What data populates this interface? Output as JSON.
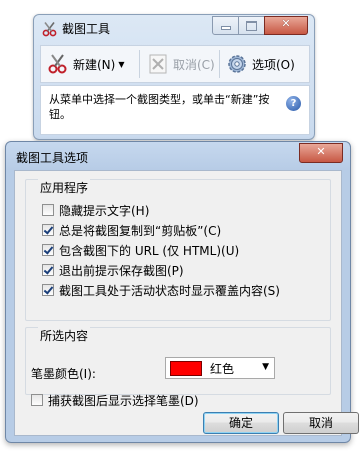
{
  "snipping_tool": {
    "title": "截图工具",
    "toolbar": {
      "new_label": "新建(N)",
      "cancel_label": "取消(C)",
      "options_label": "选项(O)"
    },
    "hint": "从菜单中选择一个截图类型，或单击“新建”按钮。"
  },
  "options_dialog": {
    "title": "截图工具选项",
    "app_group": {
      "title": "应用程序",
      "options": [
        {
          "label": "隐藏提示文字(H)",
          "checked": false
        },
        {
          "label": "总是将截图复制到“剪贴板”(C)",
          "checked": true
        },
        {
          "label": "包含截图下的 URL (仅 HTML)(U)",
          "checked": true
        },
        {
          "label": "退出前提示保存截图(P)",
          "checked": true
        },
        {
          "label": "截图工具处于活动状态时显示覆盖内容(S)",
          "checked": true
        }
      ]
    },
    "selection_group": {
      "title": "所选内容",
      "ink_color_label": "笔墨颜色(I):",
      "ink_color_value": "红色",
      "ink_color_hex": "#ff0000",
      "show_ink_label": "捕获截图后显示选择笔墨(D)",
      "show_ink_checked": false
    },
    "buttons": {
      "ok": "确定",
      "cancel": "取消"
    }
  }
}
